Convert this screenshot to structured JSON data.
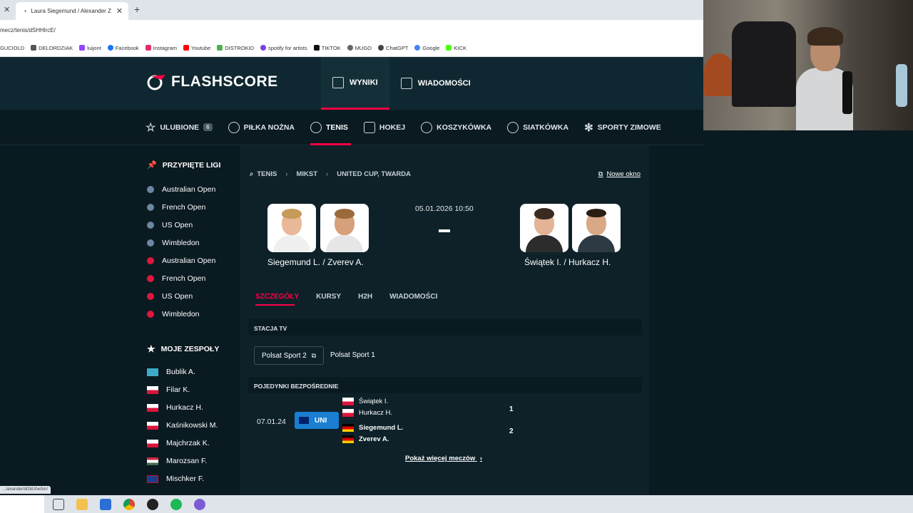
{
  "browser": {
    "tab_title": "Laura Siegemund / Alexander Z",
    "url": "mecz/tenis/dSHHlrcE/",
    "bookmarks": [
      "GUCIOLD",
      "DELORDZIAK",
      "luijont",
      "Facebook",
      "Instagram",
      "Youtube",
      "DISTROKID",
      "spotify for artists",
      "TIKTOK",
      "MUGO",
      "ChatGPT",
      "Google",
      "KICK"
    ],
    "status_url": "...lexander/dGbUhe/lsn/"
  },
  "header": {
    "logo_text": "FLASHSCORE",
    "nav": [
      {
        "label": "WYNIKI",
        "active": true
      },
      {
        "label": "WIADOMOŚCI",
        "active": false
      }
    ]
  },
  "sports": [
    {
      "label": "ULUBIONE",
      "icon": "star-icon",
      "badge": "6"
    },
    {
      "label": "PIŁKA NOŻNA",
      "icon": "football-icon"
    },
    {
      "label": "TENIS",
      "icon": "tennis-icon",
      "active": true
    },
    {
      "label": "HOKEJ",
      "icon": "hockey-icon"
    },
    {
      "label": "KOSZYKÓWKA",
      "icon": "basketball-icon"
    },
    {
      "label": "SIATKÓWKA",
      "icon": "volleyball-icon"
    },
    {
      "label": "SPORTY ZIMOWE",
      "icon": "snowflake-icon"
    }
  ],
  "sidebar": {
    "pinned_title": "PRZYPIĘTE LIGI",
    "pinned": [
      {
        "label": "Australian Open",
        "color": "blue"
      },
      {
        "label": "French Open",
        "color": "blue"
      },
      {
        "label": "US Open",
        "color": "blue"
      },
      {
        "label": "Wimbledon",
        "color": "blue"
      },
      {
        "label": "Australian Open",
        "color": "red"
      },
      {
        "label": "French Open",
        "color": "red"
      },
      {
        "label": "US Open",
        "color": "red"
      },
      {
        "label": "Wimbledon",
        "color": "red"
      }
    ],
    "teams_title": "MOJE ZESPOŁY",
    "teams": [
      {
        "label": "Bublik A.",
        "flag": "kz"
      },
      {
        "label": "Filar K.",
        "flag": "pl"
      },
      {
        "label": "Hurkacz H.",
        "flag": "pl"
      },
      {
        "label": "Kaśnikowski M.",
        "flag": "pl"
      },
      {
        "label": "Majchrzak K.",
        "flag": "pl"
      },
      {
        "label": "Marozsan F.",
        "flag": "hu"
      },
      {
        "label": "Mischker F.",
        "flag": "gb"
      }
    ]
  },
  "match": {
    "breadcrumb": [
      "TENIS",
      "MIKST",
      "UNITED CUP, TWARDA"
    ],
    "new_window": "Nowe okno",
    "date": "05.01.2026 10:50",
    "home": "Siegemund L. / Zverev A.",
    "away": "Świątek I. / Hurkacz H.",
    "tabs": [
      "SZCZEGÓŁY",
      "KURSY",
      "H2H",
      "WIADOMOŚCI"
    ],
    "tv_title": "STACJA TV",
    "tv_button": "Polsat Sport 2",
    "tv_text": "Polsat Sport 1",
    "h2h_title": "POJEDYNKI BEZPOŚREDNIE",
    "h2h": {
      "date": "07.01.24",
      "competition": "UNI",
      "players_top": [
        "Świątek I.",
        "Hurkacz H."
      ],
      "players_bottom": [
        "Siegemund L.",
        "Zverev A."
      ],
      "score_top": "1",
      "score_bottom": "2"
    },
    "show_more": "Pokaż więcej meczów"
  },
  "colors": {
    "accent": "#ff0046",
    "background": "#0a1a21",
    "panel": "#0e2129",
    "uni_badge": "#1a7fd1"
  }
}
